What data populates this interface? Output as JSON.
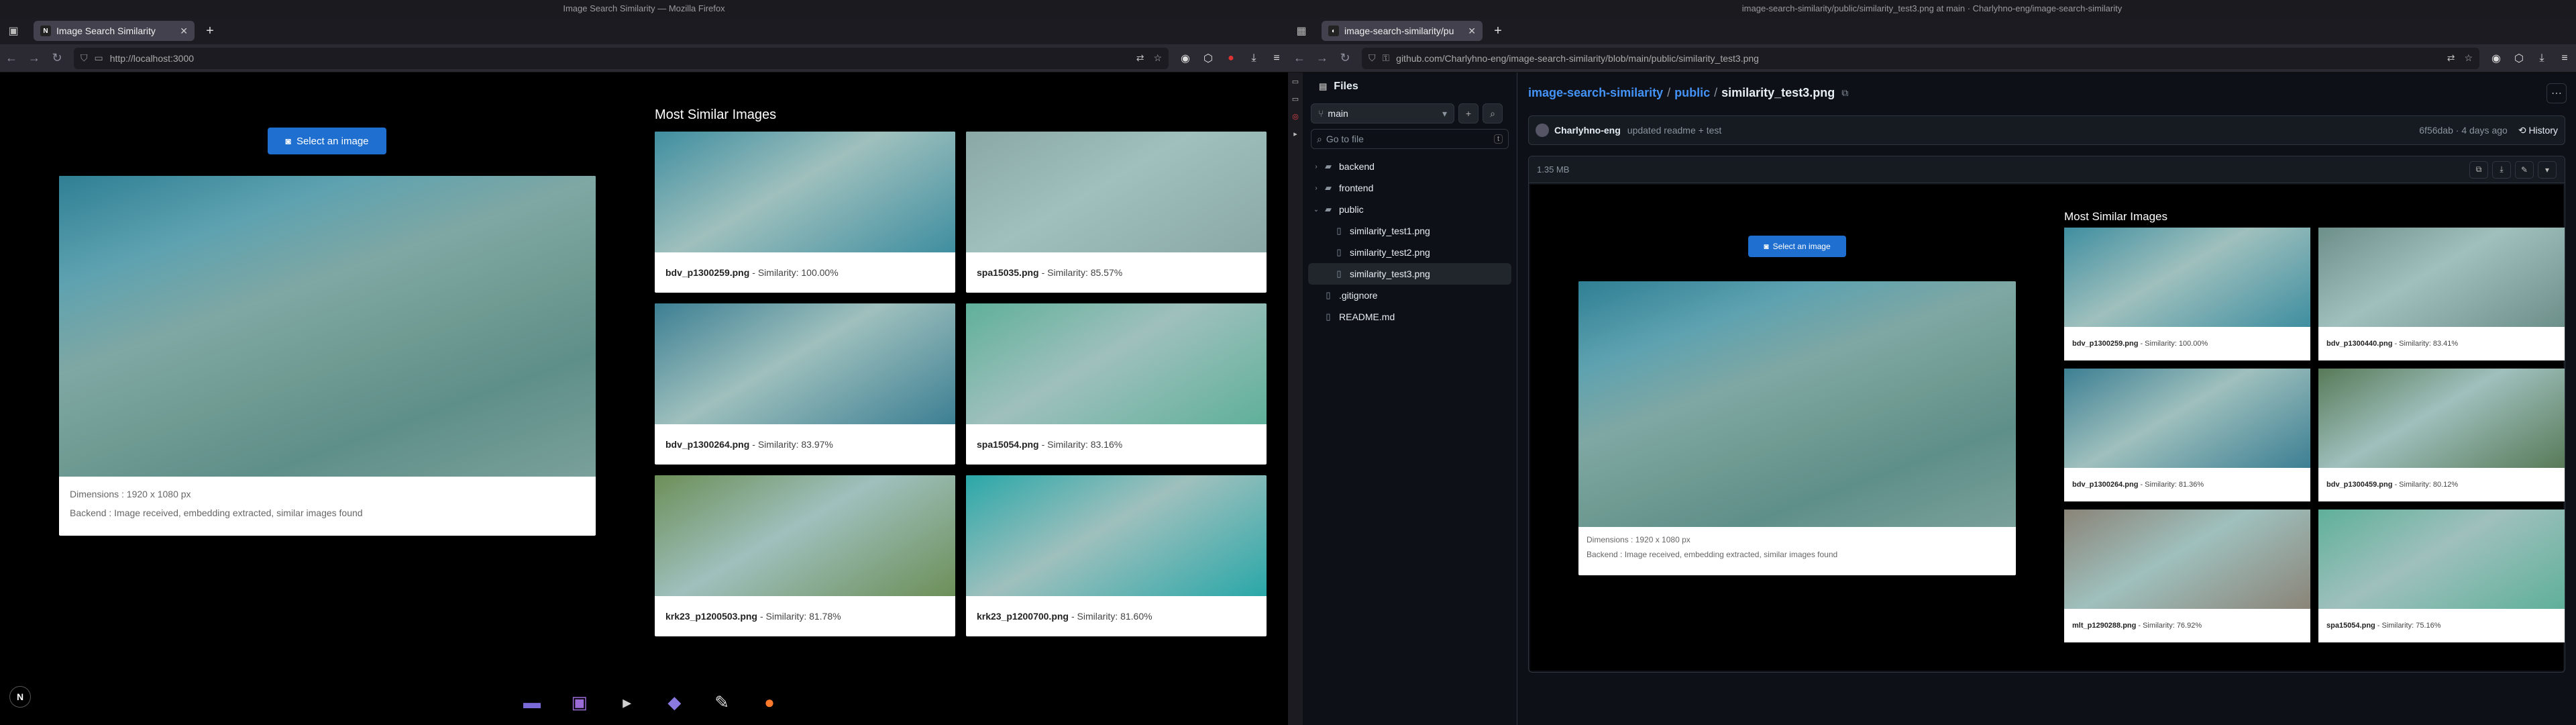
{
  "left": {
    "window_title": "Image Search Similarity — Mozilla Firefox",
    "tab_title": "Image Search Similarity",
    "url": "http://localhost:3000",
    "select_button": "Select an image",
    "dimensions": "Dimensions : 1920 x 1080 px",
    "backend": "Backend : Image received, embedding extracted, similar images found",
    "similar_title": "Most Similar Images",
    "results": [
      {
        "name": "bdv_p1300259.png",
        "sim": " - Similarity: 100.00%",
        "tone": "#3f8ea0"
      },
      {
        "name": "spa15035.png",
        "sim": " - Similarity: 85.57%",
        "tone": "#8aa8a6"
      },
      {
        "name": "bdv_p1300264.png",
        "sim": " - Similarity: 83.97%",
        "tone": "#3c7f93"
      },
      {
        "name": "spa15054.png",
        "sim": " - Similarity: 83.16%",
        "tone": "#5fb09a"
      },
      {
        "name": "krk23_p1200503.png",
        "sim": " - Similarity: 81.78%",
        "tone": "#6c8f58"
      },
      {
        "name": "krk23_p1200700.png",
        "sim": " - Similarity: 81.60%",
        "tone": "#2aa7a8"
      }
    ],
    "logo_letter": "N"
  },
  "right": {
    "window_title": "image-search-similarity/public/similarity_test3.png at main · Charlyhno-eng/image-search-similarity",
    "tab_title": "image-search-similarity/pu",
    "url": "github.com/Charlyhno-eng/image-search-similarity/blob/main/public/similarity_test3.png",
    "files_title": "Files",
    "branch": "main",
    "goto_placeholder": "Go to file",
    "goto_kbd": "t",
    "tree": [
      {
        "label": "backend",
        "kind": "folder",
        "indent": 0,
        "chev": "›",
        "sel": false
      },
      {
        "label": "frontend",
        "kind": "folder",
        "indent": 0,
        "chev": "›",
        "sel": false
      },
      {
        "label": "public",
        "kind": "folder",
        "indent": 0,
        "chev": "⌄",
        "sel": false
      },
      {
        "label": "similarity_test1.png",
        "kind": "file",
        "indent": 1,
        "chev": "",
        "sel": false
      },
      {
        "label": "similarity_test2.png",
        "kind": "file",
        "indent": 1,
        "chev": "",
        "sel": false
      },
      {
        "label": "similarity_test3.png",
        "kind": "file",
        "indent": 1,
        "chev": "",
        "sel": true
      },
      {
        "label": ".gitignore",
        "kind": "file",
        "indent": 0,
        "chev": "",
        "sel": false
      },
      {
        "label": "README.md",
        "kind": "file",
        "indent": 0,
        "chev": "",
        "sel": false
      }
    ],
    "breadcrumb": {
      "repo": "image-search-similarity",
      "folder": "public",
      "file": "similarity_test3.png"
    },
    "commit": {
      "author": "Charlyhno-eng",
      "message": "updated readme + test",
      "meta": "6f56dab · 4 days ago",
      "history": "History"
    },
    "file_size": "1.35 MB",
    "preview": {
      "select_button": "Select an image",
      "dimensions": "Dimensions : 1920 x 1080 px",
      "backend": "Backend : Image received, embedding extracted, similar images found",
      "similar_title": "Most Similar Images",
      "results": [
        {
          "name": "bdv_p1300259.png",
          "sim": " - Similarity: 100.00%",
          "tone": "#3f8ea0"
        },
        {
          "name": "bdv_p1300440.png",
          "sim": " - Similarity: 83.41%",
          "tone": "#6d8f8a"
        },
        {
          "name": "bdv_p1300264.png",
          "sim": " - Similarity: 81.36%",
          "tone": "#3c7f93"
        },
        {
          "name": "bdv_p1300459.png",
          "sim": " - Similarity: 80.12%",
          "tone": "#587a58"
        },
        {
          "name": "mlt_p1290288.png",
          "sim": " - Similarity: 76.92%",
          "tone": "#8a8478"
        },
        {
          "name": "spa15054.png",
          "sim": " - Similarity: 75.16%",
          "tone": "#5fb09a"
        }
      ]
    }
  },
  "dock": [
    {
      "name": "files-icon",
      "glyph": "▬",
      "color": "#7a6ad8"
    },
    {
      "name": "screenshot-icon",
      "glyph": "▣",
      "color": "#9b6bd8"
    },
    {
      "name": "terminal-icon",
      "glyph": "▸",
      "color": "#cfcfcf"
    },
    {
      "name": "app-icon",
      "glyph": "◆",
      "color": "#8a7ae0"
    },
    {
      "name": "editor-icon",
      "glyph": "✎",
      "color": "#dddddd"
    },
    {
      "name": "firefox-icon",
      "glyph": "●",
      "color": "#ff7a2a"
    }
  ]
}
